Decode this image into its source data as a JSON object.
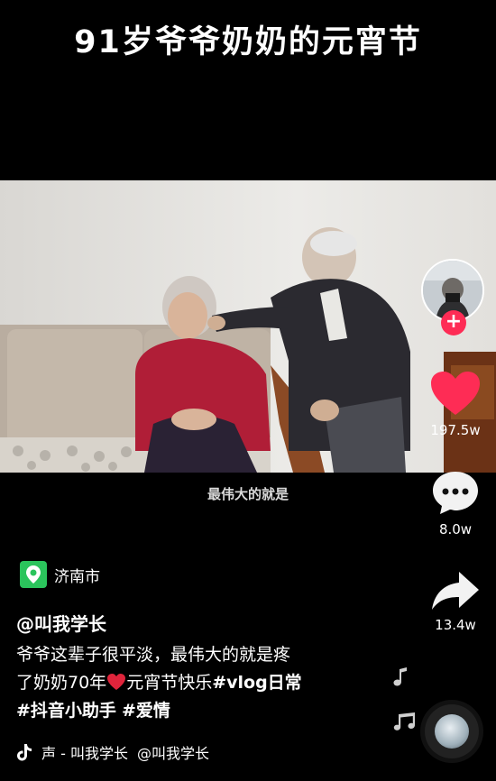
{
  "video": {
    "title": "91岁爷爷奶奶的元宵节",
    "subtitle": "最伟大的就是"
  },
  "actions": {
    "like_count": "197.5w",
    "comment_count": "8.0w",
    "share_count": "13.4w",
    "like_color": "#fe2c55"
  },
  "location": "济南市",
  "author": "@叫我学长",
  "description": {
    "line1": "爷爷这辈子很平淡，最伟大的就是疼",
    "line2_prefix": "了奶奶70年",
    "line2_mid": "元宵节快乐",
    "tag_vlog": "#vlog日常",
    "tag_helper": "#抖音小助手",
    "tag_love": "#爱情"
  },
  "music": {
    "text": "声 - 叫我学长",
    "author": "@叫我学长"
  },
  "icons": [
    "heart-icon",
    "comment-icon",
    "share-icon",
    "location-icon",
    "music-note-icon",
    "tiktok-icon",
    "plus-icon"
  ]
}
